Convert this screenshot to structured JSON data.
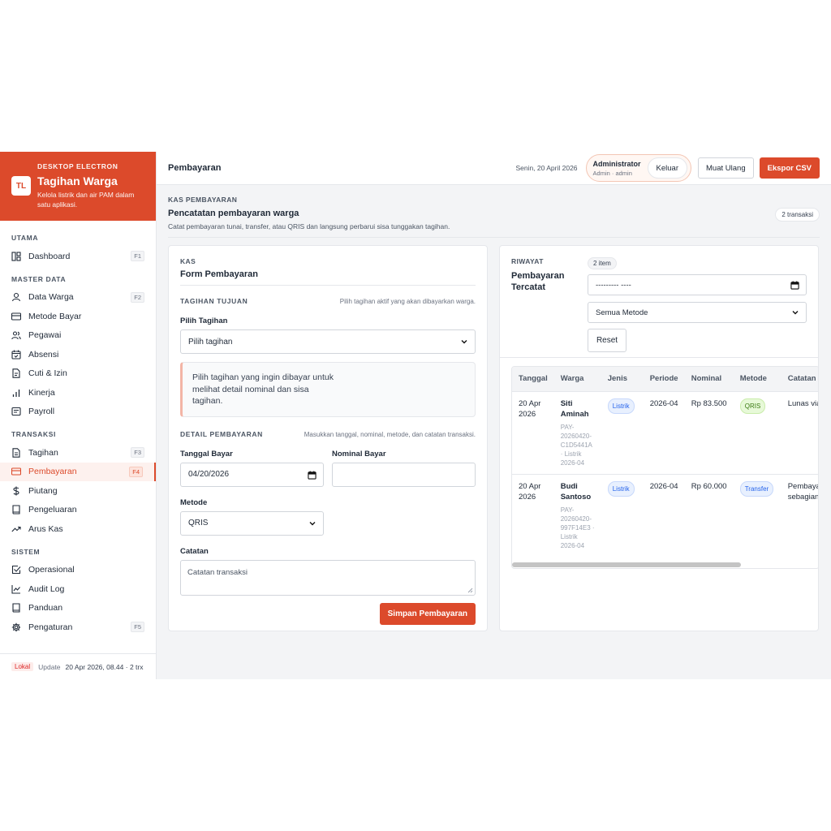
{
  "sidebar": {
    "eyebrow": "DESKTOP ELECTRON",
    "logo_text": "TL",
    "title": "Tagihan Warga",
    "subtitle": "Kelola listrik dan air PAM dalam satu aplikasi.",
    "sections": [
      {
        "label": "UTAMA",
        "items": [
          {
            "label": "Dashboard",
            "key": "F1",
            "icon": "dashboard-icon"
          }
        ]
      },
      {
        "label": "MASTER DATA",
        "items": [
          {
            "label": "Data Warga",
            "key": "F2",
            "icon": "user-icon"
          },
          {
            "label": "Metode Bayar",
            "key": "",
            "icon": "credit-card-icon"
          },
          {
            "label": "Pegawai",
            "key": "",
            "icon": "users-icon"
          },
          {
            "label": "Absensi",
            "key": "",
            "icon": "calendar-check-icon"
          },
          {
            "label": "Cuti & Izin",
            "key": "",
            "icon": "document-icon"
          },
          {
            "label": "Kinerja",
            "key": "",
            "icon": "bar-chart-icon"
          },
          {
            "label": "Payroll",
            "key": "",
            "icon": "receipt-icon"
          }
        ]
      },
      {
        "label": "TRANSAKSI",
        "items": [
          {
            "label": "Tagihan",
            "key": "F3",
            "icon": "invoice-icon"
          },
          {
            "label": "Pembayaran",
            "key": "F4",
            "icon": "credit-card-icon",
            "active": true
          },
          {
            "label": "Piutang",
            "key": "",
            "icon": "dollar-icon"
          },
          {
            "label": "Pengeluaran",
            "key": "",
            "icon": "book-icon"
          },
          {
            "label": "Arus Kas",
            "key": "",
            "icon": "trend-icon"
          }
        ]
      },
      {
        "label": "SISTEM",
        "items": [
          {
            "label": "Operasional",
            "key": "",
            "icon": "check-square-icon"
          },
          {
            "label": "Audit Log",
            "key": "",
            "icon": "line-chart-icon"
          },
          {
            "label": "Panduan",
            "key": "",
            "icon": "book-icon"
          },
          {
            "label": "Pengaturan",
            "key": "F5",
            "icon": "gear-icon"
          }
        ]
      }
    ],
    "footer": {
      "badge": "Lokal",
      "update_prefix": "Update",
      "update_value": "20 Apr 2026, 08.44 · 2 trx"
    }
  },
  "topbar": {
    "title": "Pembayaran",
    "date": "Senin, 20 April 2026",
    "user_name": "Administrator",
    "user_role": "Admin · admin",
    "logout": "Keluar",
    "reload": "Muat Ulang",
    "export": "Ekspor CSV"
  },
  "page": {
    "eyebrow": "KAS PEMBAYARAN",
    "title": "Pencatatan pembayaran warga",
    "description": "Catat pembayaran tunai, transfer, atau QRIS dan langsung perbarui sisa tunggakan tagihan.",
    "count": "2 transaksi"
  },
  "form": {
    "eyebrow": "KAS",
    "title": "Form Pembayaran",
    "section1_title": "TAGIHAN TUJUAN",
    "section1_hint": "Pilih tagihan aktif yang akan dibayarkan warga.",
    "bill_label": "Pilih Tagihan",
    "bill_value": "Pilih tagihan",
    "info_text": "Pilih tagihan yang ingin dibayar untuk melihat detail nominal dan sisa tagihan.",
    "section2_title": "DETAIL PEMBAYARAN",
    "section2_hint": "Masukkan tanggal, nominal, metode, dan catatan transaksi.",
    "date_label": "Tanggal Bayar",
    "date_value": "04/20/2026",
    "amount_label": "Nominal Bayar",
    "amount_value": "",
    "method_label": "Metode",
    "method_value": "QRIS",
    "note_label": "Catatan",
    "note_placeholder": "Catatan transaksi",
    "submit": "Simpan Pembayaran"
  },
  "history": {
    "eyebrow": "RIWAYAT",
    "title": "Pembayaran Tercatat",
    "count": "2 item",
    "date_filter": "--------- ----",
    "method_filter": "Semua Metode",
    "reset": "Reset",
    "columns": [
      "Tanggal",
      "Warga",
      "Jenis",
      "Periode",
      "Nominal",
      "Metode",
      "Catatan"
    ],
    "rows": [
      {
        "tanggal": "20 Apr 2026",
        "warga": "Siti Aminah",
        "ref": "PAY-20260420-C1D5441A · Listrik 2026-04",
        "jenis": "Listrik",
        "periode": "2026-04",
        "nominal": "Rp 83.500",
        "metode": "QRIS",
        "metode_color": "#3a7a13",
        "catatan": "Lunas via QRIS."
      },
      {
        "tanggal": "20 Apr 2026",
        "warga": "Budi Santoso",
        "ref": "PAY-20260420-997F14E3 · Listrik 2026-04",
        "jenis": "Listrik",
        "periode": "2026-04",
        "nominal": "Rp 60.000",
        "metode": "Transfer",
        "metode_color": "#2563eb",
        "catatan": "Pembayaran sebagian"
      }
    ]
  },
  "colors": {
    "accent": "#dc4a2b",
    "sidebar_active_bg": "#fdf1ee"
  }
}
